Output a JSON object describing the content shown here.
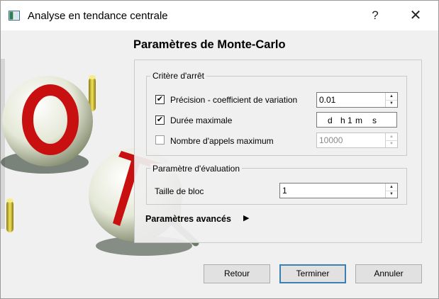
{
  "window": {
    "title": "Analyse en tendance centrale",
    "help_label": "?",
    "close_label": "✕"
  },
  "header": {
    "title": "Paramètres de Monte-Carlo"
  },
  "stop_criteria": {
    "legend": "Critère d'arrêt",
    "precision": {
      "label": "Précision - coefficient de variation",
      "checked": true,
      "value": "0.01"
    },
    "max_duration": {
      "label": "Durée maximale",
      "checked": true,
      "days_unit": "d",
      "hours_value": "",
      "hours_unit": "h",
      "minutes_value": "1",
      "minutes_unit": "m",
      "seconds_unit": "s"
    },
    "max_calls": {
      "label": "Nombre d'appels maximum",
      "checked": false,
      "value": "10000"
    }
  },
  "evaluation": {
    "legend": "Paramètre d'évaluation",
    "block_size": {
      "label": "Taille de bloc",
      "value": "1"
    }
  },
  "advanced": {
    "label": "Paramètres avancés",
    "arrow": "▶"
  },
  "buttons": {
    "back": "Retour",
    "finish": "Terminer",
    "cancel": "Annuler"
  },
  "colors": {
    "accent": "#3c7fb1",
    "dialog_bg": "#f0f0f0",
    "ball_red": "#cc1010"
  },
  "icons": {
    "app": "app-window-icon",
    "check": "✔"
  }
}
